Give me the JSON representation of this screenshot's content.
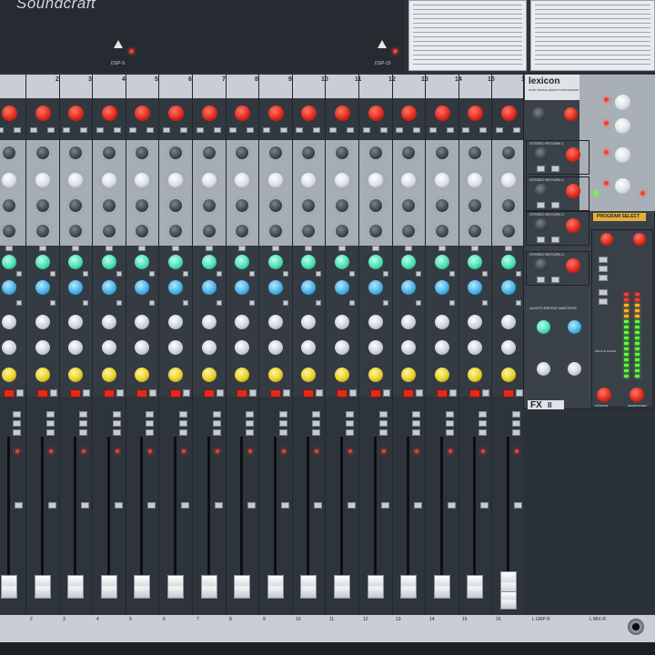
{
  "brand": {
    "name": "Soundcraft"
  },
  "top_labels": {
    "left_warn": "DSP-S",
    "right_warn": "DSP-15"
  },
  "channels": [
    "2",
    "3",
    "4",
    "5",
    "6",
    "7",
    "8",
    "9",
    "10",
    "11",
    "12",
    "13",
    "14",
    "15",
    "16"
  ],
  "bottom_labels": [
    "2",
    "3",
    "4",
    "5",
    "6",
    "7",
    "8",
    "9",
    "10",
    "11",
    "12",
    "13",
    "14",
    "15",
    "16"
  ],
  "fx_panel": {
    "lexicon_label": "lexicon",
    "lexicon_sub": "32 BIT DIGITAL EFFECTS PROCESSOR",
    "fx_logo": "FX",
    "fx_logo_suffix": "II",
    "program_select": "PROGRAM SELECT",
    "fx_section_labels": [
      "STEREO RETURN 1",
      "STEREO RETURN 2",
      "STEREO RETURN 3",
      "STEREO RETURN 4",
      "AUX/FX REPEAT MASTERS"
    ],
    "monitor": "MONITOR",
    "headphones": "HEADPHONES",
    "solo_in_place": "SOLO IN PLACE",
    "zero_db": "0dB",
    "mix_l": "L",
    "mix_r": "R",
    "grp_labels": [
      "L GRP R",
      "L MIX R"
    ]
  },
  "colors": {
    "panel_dark": "#2d333b",
    "knob_red": "#e02a1c",
    "knob_green": "#4de0b4",
    "knob_blue": "#48b4e8",
    "knob_yellow": "#e8d028",
    "fader_white": "#f0f2f4",
    "fader_red": "#e0281a",
    "fader_yellow": "#f2d21a"
  }
}
